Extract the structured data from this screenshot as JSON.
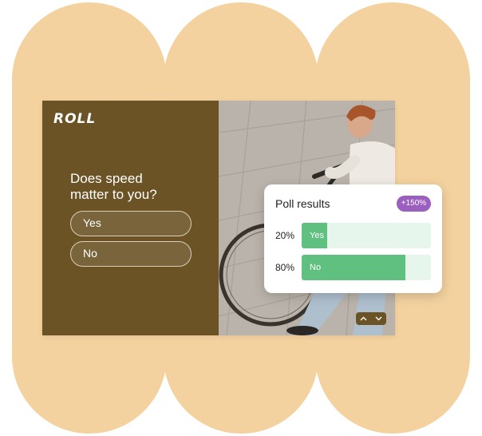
{
  "ad": {
    "brand": "ROLL",
    "question_line1": "Does speed",
    "question_line2": "matter to you?",
    "options": [
      {
        "label": "Yes"
      },
      {
        "label": "No"
      }
    ]
  },
  "poll": {
    "title": "Poll results",
    "badge": "+150%",
    "rows": [
      {
        "percent_text": "20%",
        "label": "Yes",
        "value": 0.2
      },
      {
        "percent_text": "80%",
        "label": "No",
        "value": 0.8
      }
    ]
  },
  "colors": {
    "backdrop": "#f3d29f",
    "ad_panel": "#6b5325",
    "poll_fill": "#5fc080",
    "poll_track": "#e6f6ec",
    "badge": "#9b5fc0"
  },
  "icons": [
    "chevron-up-icon",
    "chevron-down-icon"
  ]
}
